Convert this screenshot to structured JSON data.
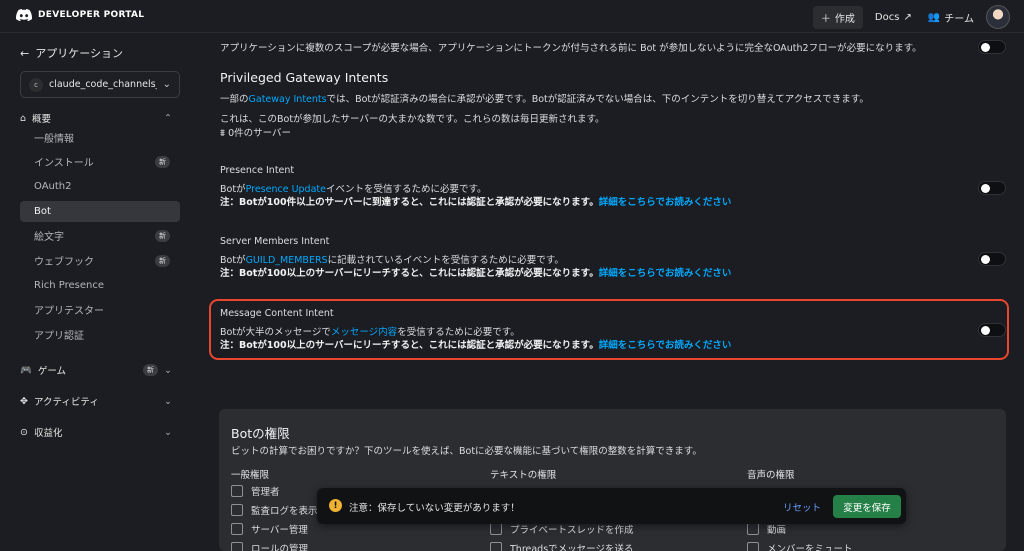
{
  "topbar": {
    "brand": "DEVELOPER PORTAL",
    "create_label": "作成",
    "docs_label": "Docs",
    "team_label": "チーム"
  },
  "sidebar": {
    "back_label": "アプリケーション",
    "app_name": "claude_code_channels_de",
    "app_initial": "c",
    "overview": {
      "label": "概要",
      "items": [
        {
          "label": "一般情報",
          "badge": ""
        },
        {
          "label": "インストール",
          "badge": "新"
        },
        {
          "label": "OAuth2",
          "badge": ""
        },
        {
          "label": "Bot",
          "badge": ""
        },
        {
          "label": "絵文字",
          "badge": "新"
        },
        {
          "label": "ウェブフック",
          "badge": "新"
        },
        {
          "label": "Rich Presence",
          "badge": ""
        },
        {
          "label": "アプリテスター",
          "badge": ""
        },
        {
          "label": "アプリ認証",
          "badge": ""
        }
      ]
    },
    "games": {
      "label": "ゲーム",
      "badge": "新"
    },
    "activities": {
      "label": "アクティビティ"
    },
    "monetization": {
      "label": "収益化"
    }
  },
  "main": {
    "top_line": "アプリケーションに複数のスコープが必要な場合、アプリケーションにトークンが付与される前に Bot が参加しないように完全なOAuth2フローが必要になります。",
    "pgi": {
      "title": "Privileged Gateway Intents",
      "desc_pre": "一部の",
      "desc_link": "Gateway Intents",
      "desc_post": "では、Botが認証済みの場合に承認が必要です。Botが認証済みでない場合は、下のインテントを切り替えてアクセスできます。",
      "approx": "これは、このBotが参加したサーバーの大まかな数です。これらの数は毎日更新されます。",
      "servers": "0件のサーバー"
    },
    "intents": [
      {
        "title": "Presence Intent",
        "line1_pre": "Botが",
        "line1_link": "Presence Update",
        "line1_post": "イベントを受信するために必要です。",
        "note_pre": "注：Botが100件以上のサーバーに到達すると、これには認証と承認が必要になります。",
        "note_link": "詳細をこちらでお読みください"
      },
      {
        "title": "Server Members Intent",
        "line1_pre": "Botが",
        "line1_link": "GUILD_MEMBERS",
        "line1_post": "に記載されているイベントを受信するために必要です。",
        "note_pre": "注：Botが100以上のサーバーにリーチすると、これには認証と承認が必要になります。",
        "note_link": "詳細をこちらでお読みください"
      },
      {
        "title": "Message Content Intent",
        "line1_pre": "Botが大半のメッセージで",
        "line1_link": "メッセージ内容",
        "line1_post": "を受信するために必要です。",
        "note_pre": "注：Botが100以上のサーバーにリーチすると、これには認証と承認が必要になります。",
        "note_link": "詳細をこちらでお読みください"
      }
    ],
    "perms": {
      "title": "Botの権限",
      "desc": "ビットの計算でお困りですか？下のツールを使えば、Botに必要な機能に基づいて権限の整数を計算できます。",
      "col1": "一般権限",
      "col2": "テキストの権限",
      "col3": "音声の権限",
      "col1_items": [
        "管理者",
        "監査ログを表示",
        "サーバー管理",
        "ロールの管理"
      ],
      "col2_items": [
        "プライベートスレッドを作成",
        "Threadsでメッセージを送る"
      ],
      "col3_items": [
        "動画",
        "メンバーをミュート"
      ]
    }
  },
  "notice": {
    "message": "注意：保存していない変更があります！",
    "reset": "リセット",
    "save": "変更を保存"
  }
}
